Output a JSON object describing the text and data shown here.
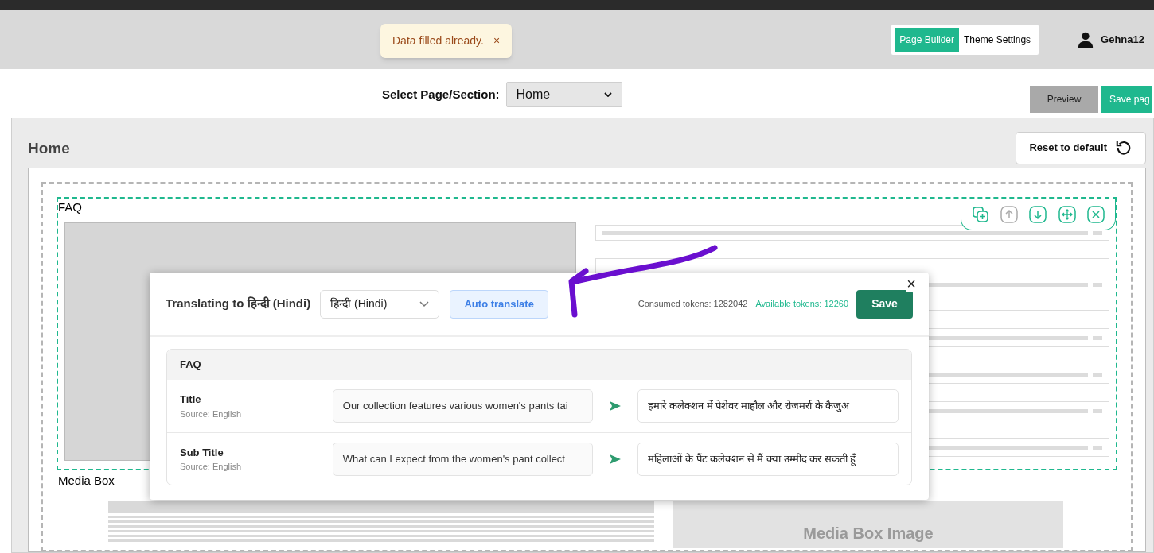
{
  "toast": {
    "message": "Data filled already.",
    "close": "×"
  },
  "header": {
    "tabs": [
      {
        "label": "Page Builder",
        "selected": true
      },
      {
        "label": "Theme Settings",
        "selected": false
      }
    ],
    "user": "Gehna12"
  },
  "toolbar": {
    "select_label": "Select Page/Section:",
    "select_value": "Home",
    "buttons": [
      {
        "label": "Preview",
        "kind": "secondary"
      },
      {
        "label": "Save pag",
        "kind": "primary"
      }
    ]
  },
  "panel": {
    "title": "Home",
    "reset_button": "Reset to default"
  },
  "sections": [
    {
      "label": "FAQ",
      "kind": "faq",
      "active": true
    },
    {
      "label": "Media Box",
      "kind": "media",
      "active": false,
      "image_label": "Media Box Image"
    }
  ],
  "modal": {
    "title": "Translating to **हिन्दी** (Hindi)",
    "language": "हिन्दी (Hindi)",
    "auto_translate": "Auto translate",
    "consumed_tokens": "Consumed tokens: 1282042",
    "available_tokens": "Available tokens: 12260",
    "save": "Save",
    "close": "×",
    "group": {
      "name": "FAQ",
      "fields": [
        {
          "label": "Title",
          "source": "Source: English",
          "original": "Our collection features various women's pants tai",
          "translation": "हमारे कलेक्शन में पेशेवर माहौल और रोजमर्रा के कैजुअ"
        },
        {
          "label": "Sub Title",
          "source": "Source: English",
          "original": "What can I expect from the women's pant collect",
          "translation": "महिलाओं के पैंट कलेक्शन से मैं क्या उम्मीद कर सकती हूँ"
        }
      ]
    }
  }
}
